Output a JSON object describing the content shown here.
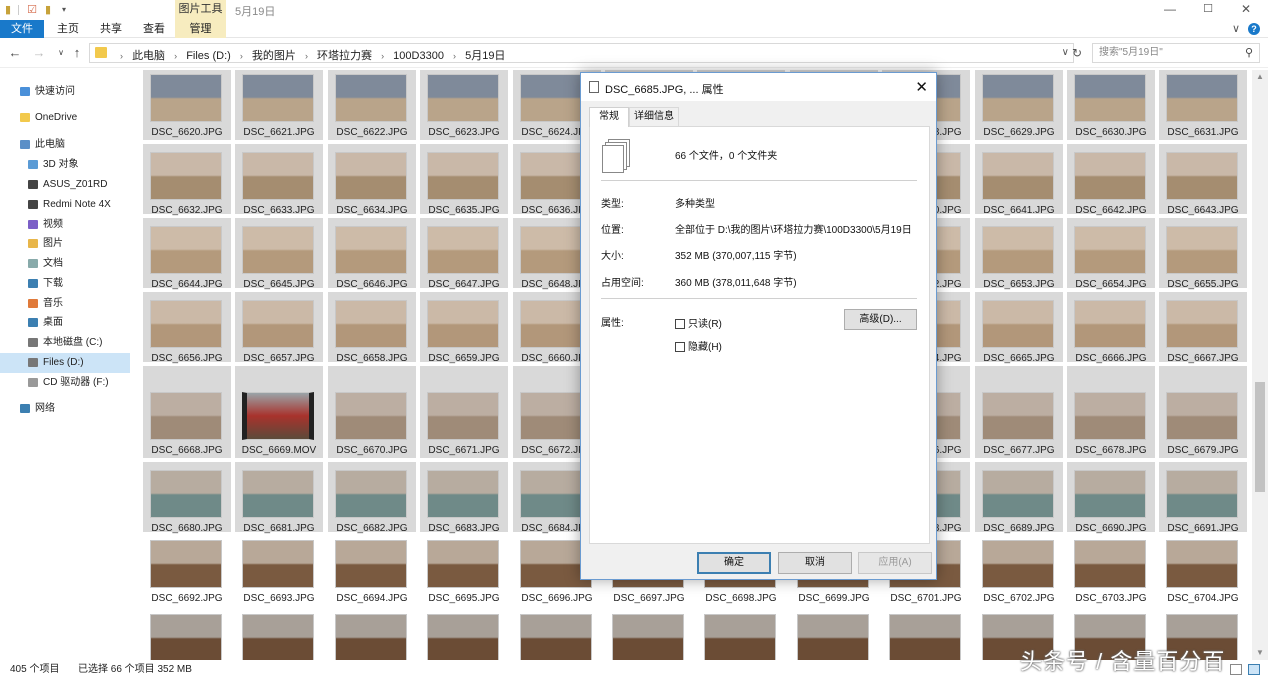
{
  "quick_access_toolbar": [
    "folder-icon",
    "properties-check-icon",
    "new-folder-icon",
    "customize-arrow-icon"
  ],
  "title": {
    "context_tab": "图片工具",
    "text": "5月19日"
  },
  "window_controls": [
    "minimize-icon",
    "maximize-icon",
    "close-icon"
  ],
  "ribbon": {
    "tabs": [
      "文件",
      "主页",
      "共享",
      "查看",
      "管理"
    ],
    "expand": "∨",
    "help": "?"
  },
  "address": {
    "breadcrumb": [
      "此电脑",
      "Files (D:)",
      "我的图片",
      "环塔拉力赛",
      "100D3300",
      "5月19日"
    ],
    "search_placeholder": "搜索\"5月19日\""
  },
  "nav": [
    {
      "label": "快速访问",
      "icon": "star-icon"
    },
    {
      "label": "OneDrive",
      "icon": "onedrive-icon"
    },
    {
      "label": "此电脑",
      "icon": "computer-icon"
    },
    {
      "label": "3D 对象",
      "icon": "3d-objects-icon"
    },
    {
      "label": "ASUS_Z01RD",
      "icon": "phone-icon"
    },
    {
      "label": "Redmi Note 4X",
      "icon": "phone-icon"
    },
    {
      "label": "视频",
      "icon": "video-icon"
    },
    {
      "label": "图片",
      "icon": "pictures-icon"
    },
    {
      "label": "文档",
      "icon": "documents-icon"
    },
    {
      "label": "下载",
      "icon": "download-icon"
    },
    {
      "label": "音乐",
      "icon": "music-icon"
    },
    {
      "label": "桌面",
      "icon": "desktop-icon"
    },
    {
      "label": "本地磁盘 (C:)",
      "icon": "drive-icon"
    },
    {
      "label": "Files (D:)",
      "icon": "drive-icon",
      "selected": true
    },
    {
      "label": "CD 驱动器 (F:)",
      "icon": "cd-drive-icon"
    },
    {
      "label": "网络",
      "icon": "network-icon"
    }
  ],
  "files": [
    [
      "DSC_6620.JPG",
      "DSC_6621.JPG",
      "DSC_6622.JPG",
      "DSC_6623.JPG",
      "DSC_6624.JPG",
      "",
      "",
      "",
      "DSC_6628.JPG",
      "DSC_6629.JPG",
      "DSC_6630.JPG",
      "DSC_6631.JPG"
    ],
    [
      "DSC_6632.JPG",
      "DSC_6633.JPG",
      "DSC_6634.JPG",
      "DSC_6635.JPG",
      "DSC_6636.JPG",
      "",
      "",
      "",
      "DSC_6640.JPG",
      "DSC_6641.JPG",
      "DSC_6642.JPG",
      "DSC_6643.JPG"
    ],
    [
      "DSC_6644.JPG",
      "DSC_6645.JPG",
      "DSC_6646.JPG",
      "DSC_6647.JPG",
      "DSC_6648.JPG",
      "",
      "",
      "",
      "DSC_6652.JPG",
      "DSC_6653.JPG",
      "DSC_6654.JPG",
      "DSC_6655.JPG"
    ],
    [
      "DSC_6656.JPG",
      "DSC_6657.JPG",
      "DSC_6658.JPG",
      "DSC_6659.JPG",
      "DSC_6660.JPG",
      "",
      "",
      "",
      "DSC_6664.JPG",
      "DSC_6665.JPG",
      "DSC_6666.JPG",
      "DSC_6667.JPG"
    ],
    [
      "DSC_6668.JPG",
      "DSC_6669.MOV",
      "DSC_6670.JPG",
      "DSC_6671.JPG",
      "DSC_6672.JPG",
      "",
      "",
      "",
      "DSC_6676.JPG",
      "DSC_6677.JPG",
      "DSC_6678.JPG",
      "DSC_6679.JPG"
    ],
    [
      "DSC_6680.JPG",
      "DSC_6681.JPG",
      "DSC_6682.JPG",
      "DSC_6683.JPG",
      "DSC_6684.JPG",
      "",
      "",
      "",
      "DSC_6688.JPG",
      "DSC_6689.JPG",
      "DSC_6690.JPG",
      "DSC_6691.JPG"
    ],
    [
      "DSC_6692.JPG",
      "DSC_6693.JPG",
      "DSC_6694.JPG",
      "DSC_6695.JPG",
      "DSC_6696.JPG",
      "DSC_6697.JPG",
      "DSC_6698.JPG",
      "DSC_6699.JPG",
      "DSC_6701.JPG",
      "DSC_6702.JPG",
      "DSC_6703.JPG",
      "DSC_6704.JPG"
    ],
    [
      "",
      "",
      "",
      "",
      "",
      "",
      "",
      "",
      "",
      "",
      "",
      ""
    ]
  ],
  "selected_rows": 6,
  "status": {
    "count": "405 个项目",
    "selection": "已选择 66 个项目  352 MB"
  },
  "watermark": "头条号 / 含量百分百",
  "dialog": {
    "title": "DSC_6685.JPG, ... 属性",
    "tabs": [
      "常规",
      "详细信息"
    ],
    "summary": "66 个文件，0 个文件夹",
    "type_label": "类型:",
    "type_value": "多种类型",
    "location_label": "位置:",
    "location_value": "全部位于 D:\\我的图片\\环塔拉力赛\\100D3300\\5月19日",
    "size_label": "大小:",
    "size_value": "352 MB (370,007,115 字节)",
    "disk_label": "占用空间:",
    "disk_value": "360 MB (378,011,648 字节)",
    "attr_label": "属性:",
    "readonly_label": "只读(R)",
    "hidden_label": "隐藏(H)",
    "advanced_label": "高级(D)...",
    "ok_label": "确定",
    "cancel_label": "取消",
    "apply_label": "应用(A)"
  }
}
